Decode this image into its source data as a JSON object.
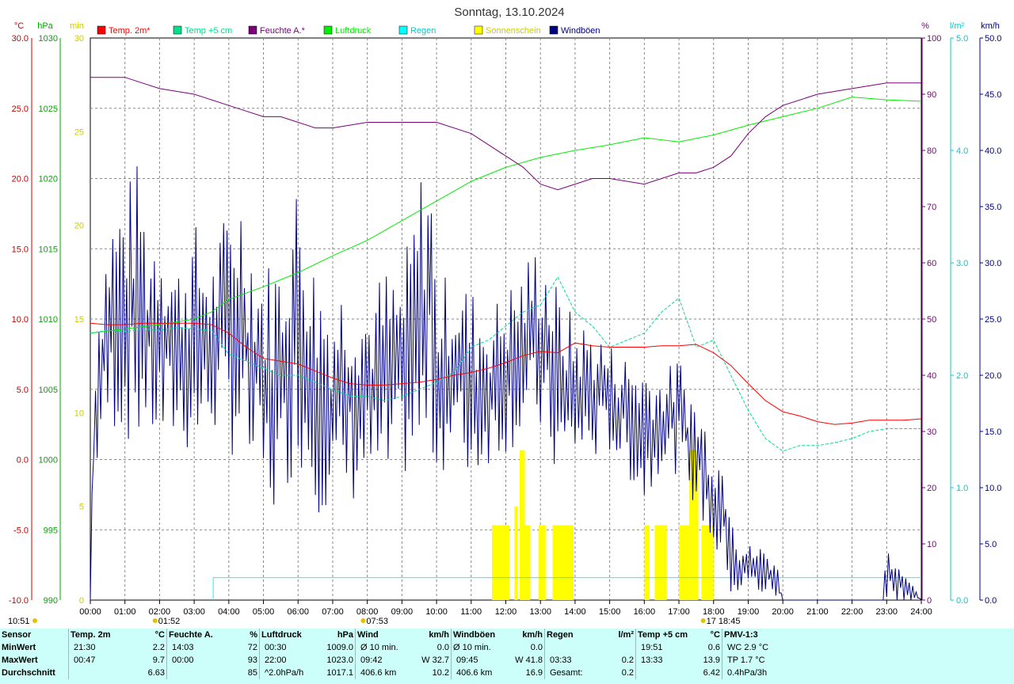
{
  "chart_data": {
    "type": "line",
    "title": "Sonntag, 13.10.2024",
    "legend": [
      "Temp. 2m*",
      "Temp +5 cm",
      "Feuchte A.*",
      "Luftdruck",
      "Regen",
      "Sonnenschein",
      "Windböen"
    ],
    "colors": {
      "temp2m": "#ff0000",
      "temp5cm": "#00e08a",
      "feuchte": "#7a007a",
      "luftdruck": "#00ee00",
      "regen": "#00ffff",
      "sonne": "#ffff00",
      "wind": "#000080",
      "grid": "#888888"
    },
    "axes": {
      "temp": {
        "unit": "°C",
        "min": -10,
        "max": 30,
        "ticks": [
          "-10.0",
          "-5.0",
          "0.0",
          "5.0",
          "10.0",
          "15.0",
          "20.0",
          "25.0",
          "30.0"
        ]
      },
      "pressure": {
        "unit": "hPa",
        "min": 990,
        "max": 1030,
        "ticks": [
          "990",
          "995",
          "1000",
          "1005",
          "1010",
          "1015",
          "1020",
          "1025",
          "1030"
        ]
      },
      "sunmin": {
        "unit": "min",
        "min": 0,
        "max": 30,
        "ticks": [
          "0",
          "5",
          "10",
          "15",
          "20",
          "25",
          "30"
        ]
      },
      "humidity": {
        "unit": "%",
        "min": 0,
        "max": 100,
        "ticks": [
          "0",
          "10",
          "20",
          "30",
          "40",
          "50",
          "60",
          "70",
          "80",
          "90",
          "100"
        ]
      },
      "rain": {
        "unit": "l/m²",
        "min": 0,
        "max": 5,
        "ticks": [
          "0.0",
          "1.0",
          "2.0",
          "3.0",
          "4.0",
          "5.0"
        ]
      },
      "wind": {
        "unit": "km/h",
        "min": 0,
        "max": 50,
        "ticks": [
          "0.0",
          "5.0",
          "10.0",
          "15.0",
          "20.0",
          "25.0",
          "30.0",
          "35.0",
          "40.0",
          "45.0",
          "50.0"
        ]
      }
    },
    "x_ticks": [
      "00:00",
      "01:00",
      "02:00",
      "03:00",
      "04:00",
      "05:00",
      "06:00",
      "07:00",
      "08:00",
      "09:00",
      "10:00",
      "11:00",
      "12:00",
      "13:00",
      "14:00",
      "15:00",
      "16:00",
      "17:00",
      "18:00",
      "19:00",
      "20:00",
      "21:00",
      "22:00",
      "23:00",
      "24:00"
    ],
    "events": [
      {
        "label": "10:51",
        "hour": 0
      },
      {
        "label": "01:52",
        "hour": 1.87
      },
      {
        "label": "07:53",
        "hour": 7.88
      },
      {
        "label": "17 18:45",
        "hour": 17.7
      }
    ],
    "series": {
      "temp2m": {
        "hours": [
          0,
          0.5,
          1,
          1.5,
          2,
          2.5,
          3,
          3.5,
          4,
          4.5,
          5,
          5.5,
          6,
          6.5,
          7,
          7.5,
          8,
          8.5,
          9,
          9.5,
          10,
          10.5,
          11,
          11.5,
          12,
          12.5,
          13,
          13.5,
          14,
          14.5,
          15,
          15.5,
          16,
          16.5,
          17,
          17.5,
          18,
          18.5,
          19,
          19.5,
          20,
          20.5,
          21,
          21.5,
          22,
          22.5,
          23,
          23.5,
          24
        ],
        "values": [
          9.7,
          9.6,
          9.6,
          9.7,
          9.7,
          9.7,
          9.7,
          9.6,
          9.0,
          8.0,
          7.2,
          7.0,
          6.8,
          6.3,
          5.8,
          5.4,
          5.3,
          5.3,
          5.4,
          5.5,
          5.7,
          6.0,
          6.2,
          6.5,
          6.9,
          7.4,
          7.7,
          7.6,
          8.3,
          8.1,
          8.0,
          8.0,
          8.0,
          8.1,
          8.1,
          8.2,
          7.6,
          6.7,
          5.4,
          4.2,
          3.4,
          3.1,
          2.7,
          2.5,
          2.6,
          2.8,
          2.8,
          2.8,
          2.9
        ]
      },
      "temp5cm": {
        "hours": [
          0,
          0.5,
          1,
          1.5,
          2,
          2.5,
          3,
          3.5,
          4,
          4.5,
          5,
          5.5,
          6,
          6.5,
          7,
          7.5,
          8,
          8.5,
          9,
          9.5,
          10,
          10.5,
          11,
          11.5,
          12,
          12.5,
          13,
          13.5,
          14,
          14.5,
          15,
          15.5,
          16,
          16.5,
          17,
          17.5,
          18,
          18.5,
          19,
          19.5,
          20,
          20.5,
          21,
          21.5,
          22,
          22.5,
          23,
          23.5,
          24
        ],
        "values": [
          9.0,
          9.2,
          9.1,
          9.3,
          9.2,
          9.4,
          9.3,
          9.2,
          7.5,
          7.0,
          6.5,
          6.0,
          6.0,
          5.5,
          5.0,
          4.5,
          4.5,
          4.2,
          4.5,
          5.0,
          5.5,
          6.2,
          8.0,
          8.5,
          9.5,
          10.5,
          11.0,
          13.0,
          10.5,
          9.5,
          8.0,
          8.5,
          9.0,
          10.5,
          11.5,
          8.0,
          8.5,
          6.0,
          3.5,
          1.5,
          0.6,
          1.0,
          1.0,
          1.2,
          1.5,
          2.0,
          2.2,
          2.2,
          2.2
        ]
      },
      "feuchte": {
        "hours": [
          0,
          1,
          1.5,
          2,
          3,
          4,
          4.5,
          5,
          5.5,
          6,
          6.5,
          7,
          8,
          9,
          10,
          11,
          12,
          12.5,
          13,
          13.5,
          14,
          14.5,
          15,
          16,
          17,
          17.5,
          18,
          18.5,
          19,
          19.5,
          20,
          21,
          22,
          23,
          24
        ],
        "values": [
          93,
          93,
          92,
          91,
          90,
          88,
          87,
          86,
          86,
          85,
          84,
          84,
          85,
          85,
          85,
          83,
          79,
          77,
          74,
          73,
          74,
          75,
          75,
          74,
          76,
          76,
          77,
          79,
          83,
          86,
          88,
          90,
          91,
          92,
          92
        ]
      },
      "luftdruck": {
        "hours": [
          0,
          1,
          2,
          3,
          3.5,
          4,
          5,
          6,
          7,
          8,
          9,
          10,
          11,
          12,
          13,
          14,
          15,
          16,
          17,
          18,
          19,
          20,
          21,
          22,
          23,
          24
        ],
        "values": [
          1009.0,
          1009.3,
          1009.6,
          1010.0,
          1010.5,
          1011.4,
          1012.3,
          1013.3,
          1014.5,
          1015.6,
          1017.0,
          1018.4,
          1019.8,
          1020.8,
          1021.5,
          1022.0,
          1022.4,
          1022.9,
          1022.6,
          1023.1,
          1023.8,
          1024.4,
          1025.0,
          1025.8,
          1025.6,
          1025.5
        ]
      },
      "regen": {
        "start_hour": 3.55,
        "end_hour": 24,
        "total": 0.2
      },
      "sonne": [
        {
          "from": 11.6,
          "to": 12.1,
          "min": 4
        },
        {
          "from": 12.25,
          "to": 12.35,
          "min": 5
        },
        {
          "from": 12.4,
          "to": 12.55,
          "min": 8
        },
        {
          "from": 12.55,
          "to": 12.7,
          "min": 4
        },
        {
          "from": 12.95,
          "to": 13.15,
          "min": 4
        },
        {
          "from": 13.35,
          "to": 13.95,
          "min": 4
        },
        {
          "from": 16.0,
          "to": 16.15,
          "min": 4
        },
        {
          "from": 16.3,
          "to": 16.65,
          "min": 4
        },
        {
          "from": 17.0,
          "to": 17.3,
          "min": 4
        },
        {
          "from": 17.3,
          "to": 17.55,
          "min": 8
        },
        {
          "from": 17.65,
          "to": 18.0,
          "min": 4
        }
      ],
      "wind_envelope": {
        "hours": [
          0,
          0.1,
          0.3,
          0.6,
          1,
          1.5,
          1.6,
          2,
          2.5,
          3,
          3.5,
          4,
          4.3,
          4.6,
          5,
          5.5,
          5.7,
          6,
          6.5,
          7,
          7.5,
          8,
          8.5,
          9,
          9.5,
          9.8,
          10,
          10.5,
          11,
          11.5,
          12,
          12.5,
          13,
          13.5,
          14,
          14.5,
          15,
          15.5,
          16,
          16.5,
          17,
          17.5,
          18,
          18.5,
          18.7,
          19,
          19.5,
          19.8,
          20,
          22.9,
          23,
          23.1,
          24
        ],
        "upper": [
          0,
          22,
          30,
          35,
          37,
          40,
          32,
          36,
          30,
          34,
          30,
          36,
          38,
          34,
          30,
          32,
          35,
          38,
          30,
          28,
          30,
          27,
          30,
          29,
          38,
          42,
          28,
          30,
          28,
          26,
          28,
          30,
          33,
          28,
          25,
          25,
          23,
          22,
          22,
          20,
          22,
          18,
          15,
          12,
          6,
          5,
          5,
          4,
          0,
          0,
          6,
          5,
          0
        ],
        "lower": [
          0,
          10,
          12,
          15,
          14,
          13,
          15,
          12,
          14,
          12,
          15,
          13,
          12,
          10,
          8,
          6,
          10,
          12,
          8,
          7,
          8,
          10,
          8,
          11,
          10,
          12,
          11,
          12,
          10,
          12,
          13,
          14,
          14,
          10,
          12,
          12,
          13,
          11,
          8,
          12,
          11,
          8,
          4,
          0,
          0,
          1,
          0,
          0,
          0,
          0,
          0,
          0,
          0
        ]
      }
    }
  },
  "stats": {
    "headers": {
      "sensor": "Sensor",
      "temp2m": "Temp. 2m",
      "temp2m_u": "°C",
      "feuchte": "Feuchte A.",
      "feuchte_u": "%",
      "luft": "Luftdruck",
      "luft_u": "hPa",
      "wind": "Wind",
      "wind_u": "km/h",
      "boen": "Windböen",
      "boen_u": "km/h",
      "regen": "Regen",
      "regen_u": "l/m²",
      "t5": "Temp +5 cm",
      "t5_u": "°C",
      "pmv": "PMV-1:3"
    },
    "rows": [
      {
        "label": "MinWert",
        "temp_t": "21:30",
        "temp_v": "2.2",
        "feu_t": "14:03",
        "feu_v": "72",
        "luft_t": "00:30",
        "luft_v": "1009.0",
        "wind_t": "Ø 10 min.",
        "wind_v": "0.0",
        "boen_t": "Ø 10 min.",
        "boen_v": "0.0",
        "regen_t": "",
        "regen_v": "",
        "t5_t": "19:51",
        "t5_v": "0.6",
        "pmv": "WC 2.9 °C"
      },
      {
        "label": "MaxWert",
        "temp_t": "00:47",
        "temp_v": "9.7",
        "feu_t": "00:00",
        "feu_v": "93",
        "luft_t": "22:00",
        "luft_v": "1023.0",
        "wind_t": "09:42",
        "wind_v": "W 32.7",
        "boen_t": "09:45",
        "boen_v": "W 41.8",
        "regen_t": "03:33",
        "regen_v": "0.2",
        "t5_t": "13:33",
        "t5_v": "13.9",
        "pmv": "TP 1.7 °C"
      },
      {
        "label": "Durchschnitt",
        "temp_t": "",
        "temp_v": "6.63",
        "feu_t": "",
        "feu_v": "85",
        "luft_t": "^2.0hPa/h",
        "luft_v": "1017.1",
        "wind_t": "406.6 km",
        "wind_v": "10.2",
        "boen_t": "406.6 km",
        "boen_v": "16.9",
        "regen_t": "Gesamt:",
        "regen_v": "0.2",
        "t5_t": "",
        "t5_v": "6.42",
        "pmv": "0.4hPa/3h"
      }
    ]
  }
}
